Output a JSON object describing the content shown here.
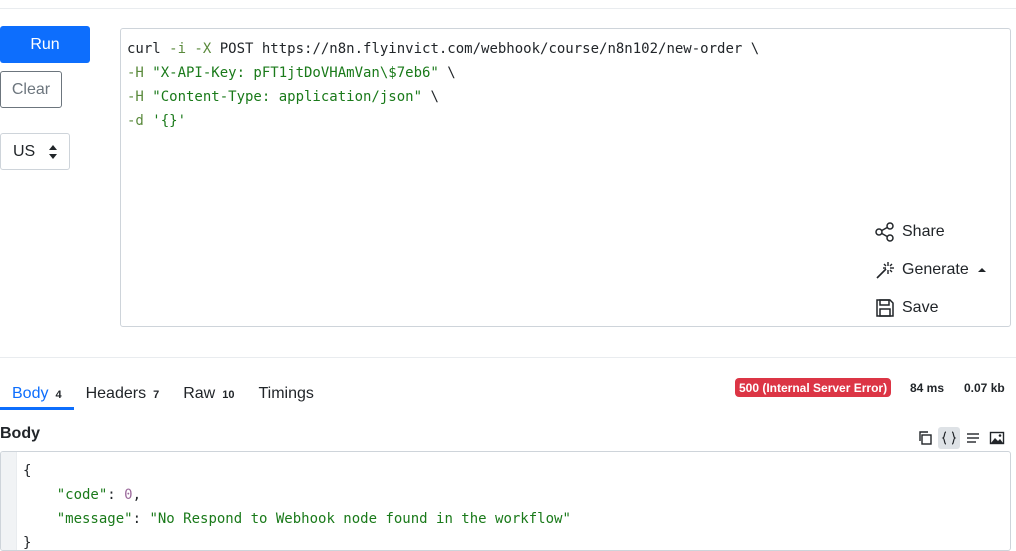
{
  "toolbar": {
    "run_label": "Run",
    "clear_label": "Clear",
    "region_value": "US"
  },
  "request": {
    "line1_cmd": "curl",
    "line1_flags": " -i -X",
    "line1_rest": " POST https://n8n.flyinvict.com/webhook/course/n8n102/new-order \\",
    "line2_flag": "-H",
    "line2_str": " \"X-API-Key: pFT1jtDoVHAmVan\\$7eb6\"",
    "line2_tail": " \\",
    "line3_flag": "-H",
    "line3_str": " \"Content-Type: application/json\"",
    "line3_tail": " \\",
    "line4_flag": "-d",
    "line4_str": " '{}'"
  },
  "actions": {
    "share_label": "Share",
    "generate_label": "Generate",
    "save_label": "Save"
  },
  "tabs": [
    {
      "label": "Body",
      "count": "4"
    },
    {
      "label": "Headers",
      "count": "7"
    },
    {
      "label": "Raw",
      "count": "10"
    },
    {
      "label": "Timings",
      "count": ""
    }
  ],
  "response_meta": {
    "status": "500 (Internal Server Error)",
    "time": "84 ms",
    "size": "0.07 kb",
    "status_color": "#dc3545"
  },
  "body_section": {
    "title": "Body"
  },
  "response_json": {
    "open_brace": "{",
    "code_key": "\"code\"",
    "code_val": "0",
    "message_key": "\"message\"",
    "message_val": "\"No Respond to Webhook node found in the workflow\"",
    "close_brace": "}"
  },
  "icons": {
    "share": "share-icon",
    "generate": "magic-wand-icon",
    "save": "floppy-disk-icon",
    "copy": "copy-icon",
    "json_view": "braces-icon",
    "text_view": "lines-icon",
    "image_view": "image-icon"
  },
  "colors": {
    "primary": "#0d6efd",
    "error": "#dc3545"
  }
}
